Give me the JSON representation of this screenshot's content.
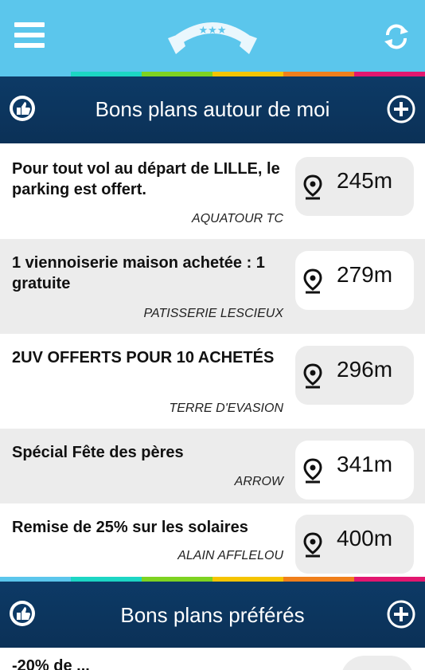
{
  "colors": {
    "topbar": "#5bc6ec",
    "header": "#0d3a66",
    "rainbow": [
      "#5bc6ec",
      "#1cd6c4",
      "#7ed321",
      "#f5c400",
      "#f07f1b",
      "#e2176f"
    ]
  },
  "topbar": {
    "menu_icon": "hamburger-icon",
    "logo_icon": "stars-banner-logo",
    "refresh_icon": "refresh-icon"
  },
  "nearby": {
    "title": "Bons plans autour de moi",
    "deals": [
      {
        "text": "Pour tout vol au départ de LILLE, le parking est offert.",
        "merchant": "AQUATOUR TC",
        "distance": "245m"
      },
      {
        "text": "1 viennoiserie maison achetée : 1 gratuite",
        "merchant": "PATISSERIE LESCIEUX",
        "distance": "279m"
      },
      {
        "text": "2UV OFFERTS POUR 10 ACHETÉS",
        "merchant": "TERRE D'EVASION",
        "distance": "296m"
      },
      {
        "text": "Spécial Fête des pères",
        "merchant": "ARROW",
        "distance": "341m"
      },
      {
        "text": "Remise de 25% sur les solaires",
        "merchant": "ALAIN AFFLELOU",
        "distance": "400m"
      }
    ]
  },
  "favorites": {
    "title": "Bons plans préférés",
    "partial_text": "-20% de ..."
  }
}
